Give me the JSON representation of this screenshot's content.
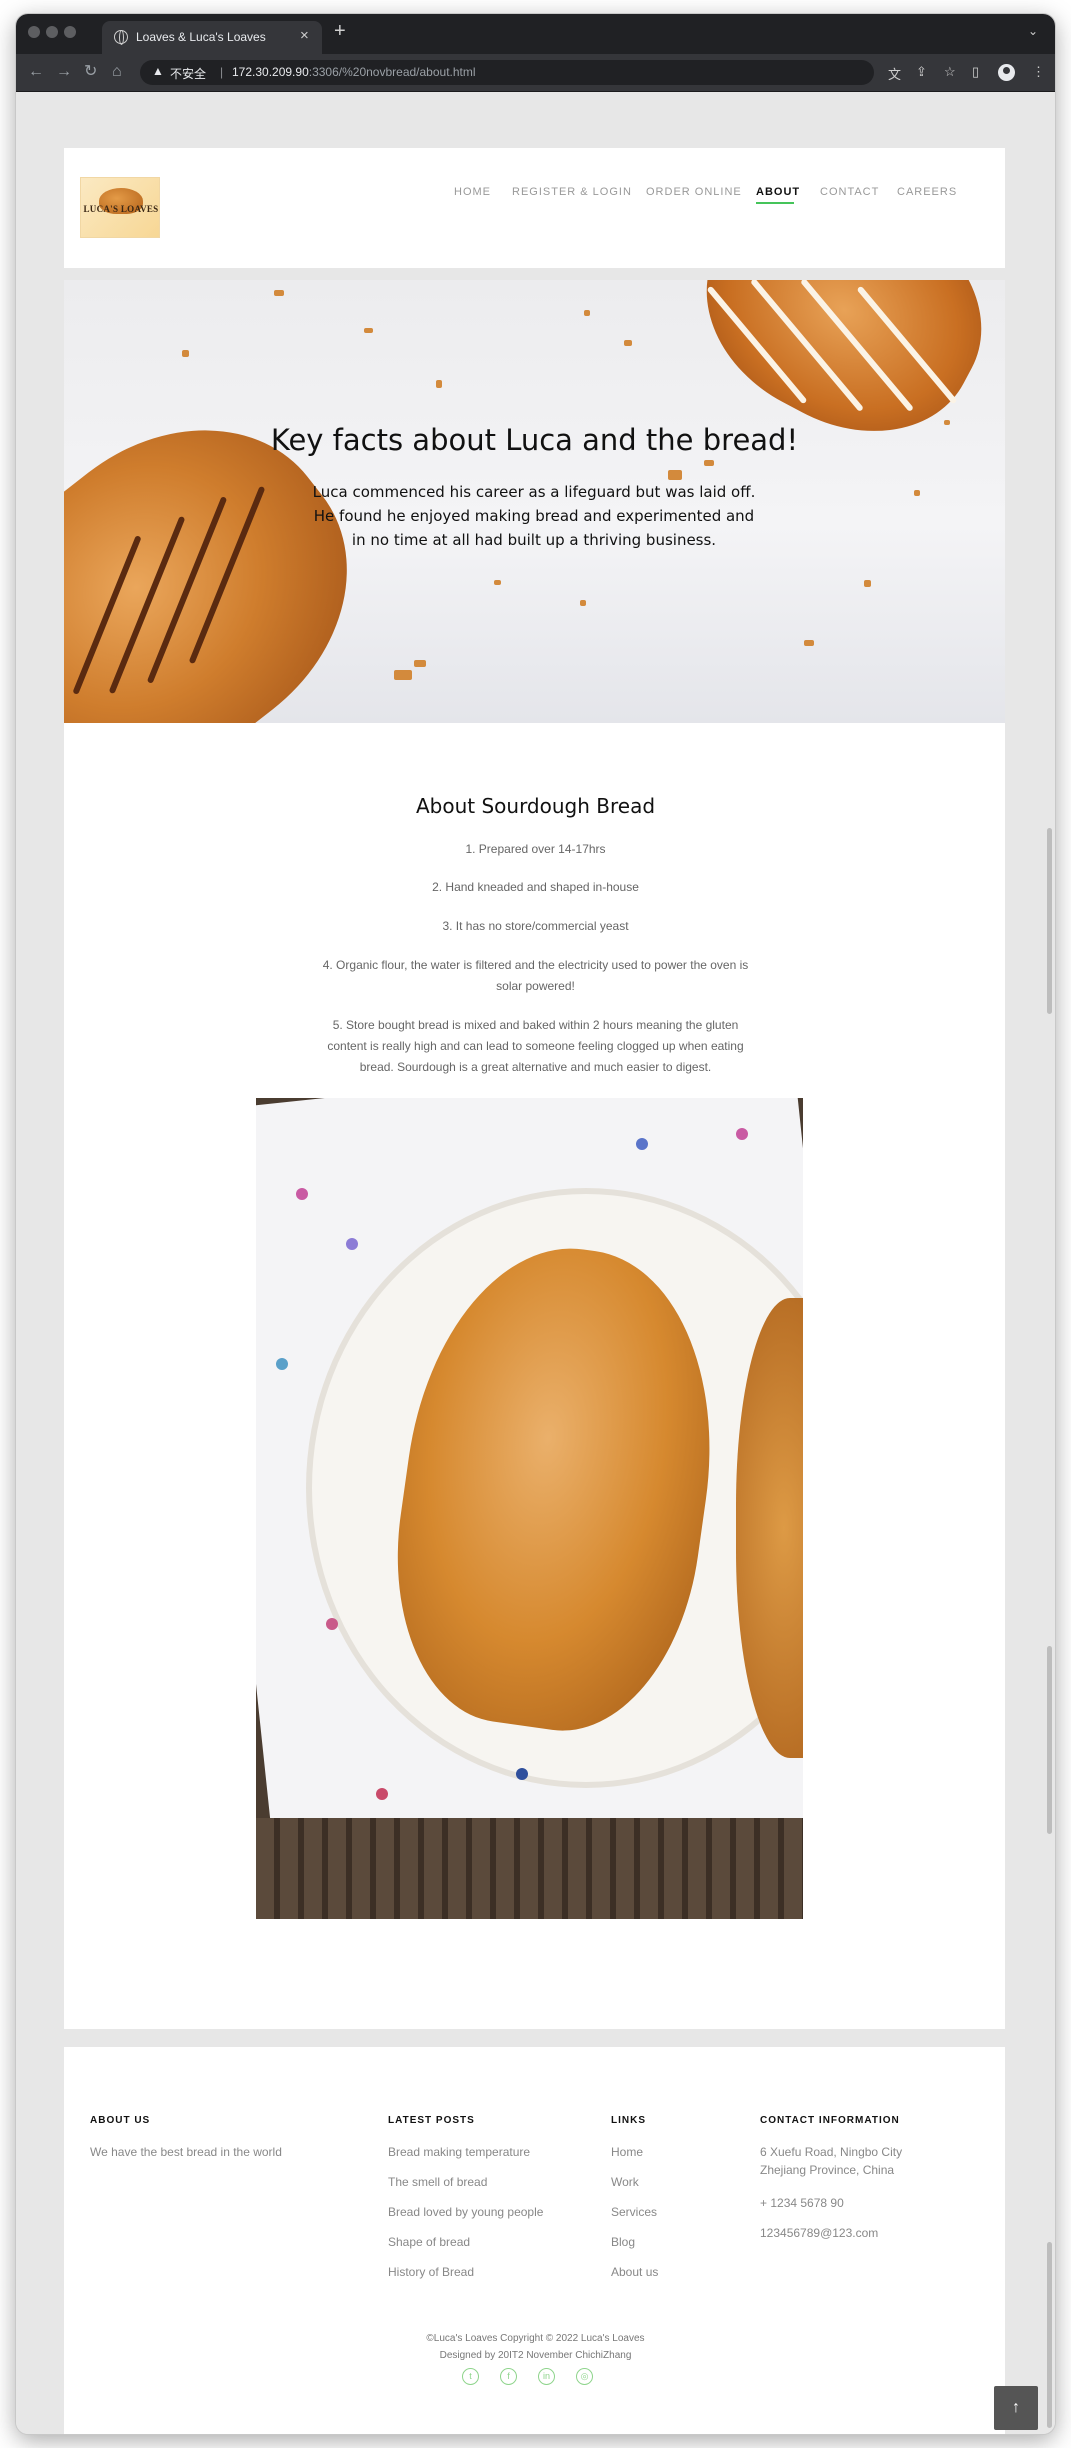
{
  "browser": {
    "tab_title": "Loaves & Luca's Loaves",
    "security_label": "不安全",
    "url_host": "172.30.209.90",
    "url_path": ":3306/%20novbread/about.html"
  },
  "site": {
    "logo_text": "LUCA'S LOAVES",
    "nav": [
      "HOME",
      "REGISTER & LOGIN",
      "ORDER ONLINE",
      "ABOUT",
      "CONTACT",
      "CAREERS"
    ],
    "active_nav": "ABOUT",
    "accent_color": "#45c45a"
  },
  "hero": {
    "title": "Key facts about Luca and the bread!",
    "text": "Luca commenced his career as a lifeguard but was laid off. He found he enjoyed making bread and experimented and in no time at all had built up a thriving business."
  },
  "about": {
    "title": "About Sourdough Bread",
    "facts": [
      "1. Prepared over 14-17hrs",
      "2. Hand kneaded and shaped in-house",
      "3. It has no store/commercial yeast",
      "4. Organic flour, the water is filtered and the electricity used to power the oven is solar powered!",
      "5. Store bought bread is mixed and baked within 2 hours meaning the gluten content is really high and can lead to someone feeling clogged up when eating bread. Sourdough is a great alternative and much easier to digest."
    ]
  },
  "footer": {
    "about_heading": "ABOUT US",
    "about_text": "We have the best bread in the world",
    "posts_heading": "LATEST POSTS",
    "posts": [
      "Bread making temperature",
      "The smell of bread",
      "Bread loved by young people",
      "Shape of bread",
      "History of Bread"
    ],
    "links_heading": "LINKS",
    "links": [
      "Home",
      "Work",
      "Services",
      "Blog",
      "About us"
    ],
    "contact_heading": "CONTACT INFORMATION",
    "address_line1": "6 Xuefu Road, Ningbo City",
    "address_line2": "Zhejiang Province, China",
    "phone": "+ 1234 5678 90",
    "email": "123456789@123.com",
    "copyright": "©Luca's Loaves Copyright © 2022 Luca's Loaves",
    "designed_by": "Designed by 20IT2 November ChichiZhang",
    "social_icons": [
      "twitter-icon",
      "facebook-icon",
      "linkedin-icon",
      "dribbble-icon"
    ]
  }
}
